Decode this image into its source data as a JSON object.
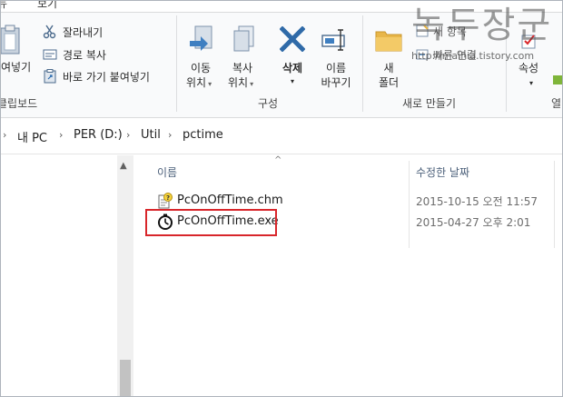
{
  "ribbon": {
    "tabs": [
      "뉴",
      "보기"
    ],
    "clipboard": {
      "paste_partial": "여넣기",
      "cut": "잘라내기",
      "copy_path": "경로 복사",
      "paste_shortcut": "바로 가기 붙여넣기",
      "group_label": "클립보드"
    },
    "organize": {
      "move_to": [
        "이동",
        "위치"
      ],
      "copy_to": [
        "복사",
        "위치"
      ],
      "delete": "삭제",
      "rename": [
        "이름",
        "바꾸기"
      ],
      "group_label": "구성"
    },
    "new": {
      "new_folder": [
        "새",
        "폴더"
      ],
      "new_item": "새 항목",
      "easy_access": "빠른 연결",
      "group_label": "새로 만들기"
    },
    "open": {
      "properties": "속성",
      "group_label_partial": "열"
    }
  },
  "watermark": {
    "title": "녹두장군",
    "url": "http://mainia.tistory.com"
  },
  "address": {
    "crumbs": [
      "내 PC",
      "PER (D:)",
      "Util",
      "pctime"
    ]
  },
  "columns": {
    "name": "이름",
    "modified": "수정한 날짜"
  },
  "files": [
    {
      "name": "PcOnOffTime.chm",
      "date": "2015-10-15 오전 11:57",
      "icon": "help-file-icon"
    },
    {
      "name": "PcOnOffTime.exe",
      "date": "2015-04-27 오후 2:01",
      "icon": "clock-exe-icon"
    }
  ],
  "colors": {
    "highlight": "#d8262b",
    "header_text": "#4c607a",
    "folder": "#e8b649",
    "delete_x": "#2b6cb0"
  }
}
